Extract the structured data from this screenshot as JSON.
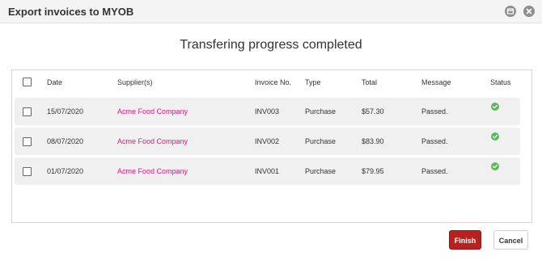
{
  "window": {
    "title": "Export invoices to MYOB",
    "restore_icon": "restore-icon",
    "close_icon": "close-icon"
  },
  "heading": "Transfering progress completed",
  "columns": {
    "date": "Date",
    "supplier": "Supplier(s)",
    "invoice": "Invoice No.",
    "type": "Type",
    "total": "Total",
    "message": "Message",
    "status": "Status"
  },
  "rows": [
    {
      "date": "15/07/2020",
      "supplier": "Acme Food Company",
      "invoice": "INV003",
      "type": "Purchase",
      "total": "$57.30",
      "message": "Passed.",
      "status_icon": "check-circle-icon"
    },
    {
      "date": "08/07/2020",
      "supplier": "Acme Food Company",
      "invoice": "INV002",
      "type": "Purchase",
      "total": "$83.90",
      "message": "Passed.",
      "status_icon": "check-circle-icon"
    },
    {
      "date": "01/07/2020",
      "supplier": "Acme Food Company",
      "invoice": "INV001",
      "type": "Purchase",
      "total": "$79.95",
      "message": "Passed.",
      "status_icon": "check-circle-icon"
    }
  ],
  "buttons": {
    "finish": "Finish",
    "cancel": "Cancel"
  },
  "colors": {
    "finish_bg": "#b9211e",
    "supplier_link": "#e0177a",
    "status_ok": "#5cb85c"
  }
}
